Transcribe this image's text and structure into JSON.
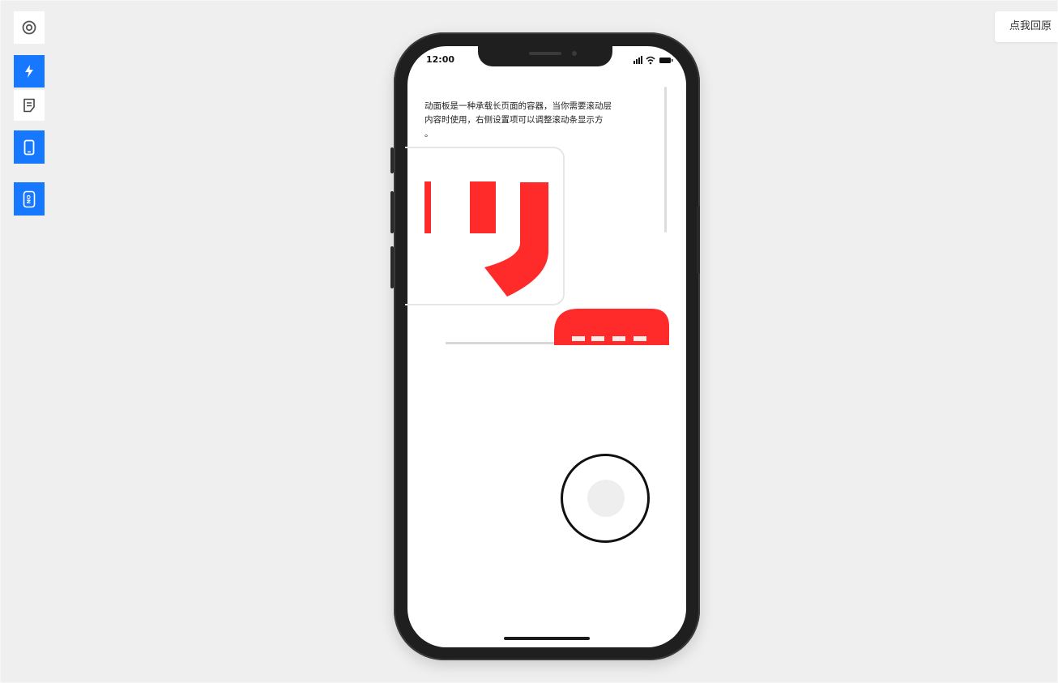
{
  "top_right_button": {
    "label": "点我回原"
  },
  "toolbar": {
    "items": [
      {
        "icon": "target-icon",
        "active": false
      },
      {
        "icon": "lightning-icon",
        "active": true
      },
      {
        "icon": "document-icon",
        "active": false
      },
      {
        "icon": "mobile-icon",
        "active": true
      },
      {
        "icon": "toggle-on-icon",
        "active": true,
        "label": "ON"
      }
    ]
  },
  "phone": {
    "status_time": "12:00",
    "description": "动面板是一种承载长页面的容器，当你需要滚动层\n内容时使用，右侧设置项可以调整滚动条显示方\n。"
  },
  "colors": {
    "accent": "#1677ff",
    "brand_red": "#ff2a2a",
    "background": "#efefef"
  }
}
